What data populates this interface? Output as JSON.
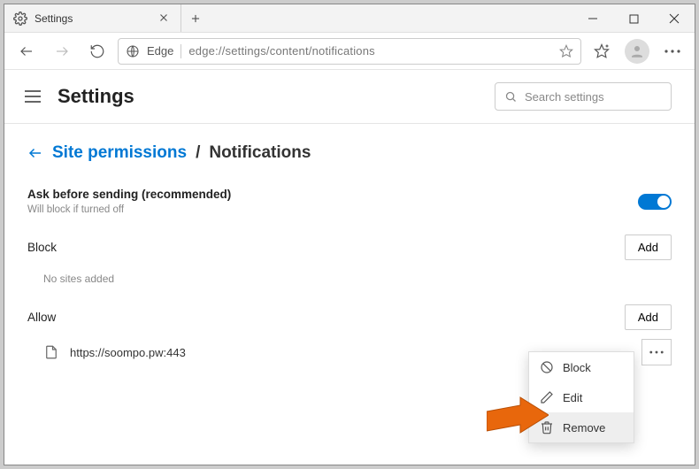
{
  "tab": {
    "title": "Settings"
  },
  "address": {
    "scheme_label": "Edge",
    "url": "edge://settings/content/notifications"
  },
  "header": {
    "title": "Settings",
    "search_placeholder": "Search settings"
  },
  "breadcrumb": {
    "parent": "Site permissions",
    "separator": "/",
    "current": "Notifications"
  },
  "ask": {
    "label": "Ask before sending (recommended)",
    "sub": "Will block if turned off",
    "enabled": true
  },
  "block": {
    "title": "Block",
    "add_label": "Add",
    "empty": "No sites added"
  },
  "allow": {
    "title": "Allow",
    "add_label": "Add",
    "sites": [
      {
        "url": "https://soompo.pw:443"
      }
    ]
  },
  "context_menu": {
    "items": [
      {
        "label": "Block",
        "icon": "block-icon"
      },
      {
        "label": "Edit",
        "icon": "edit-icon"
      },
      {
        "label": "Remove",
        "icon": "trash-icon"
      }
    ],
    "hover_index": 2
  }
}
